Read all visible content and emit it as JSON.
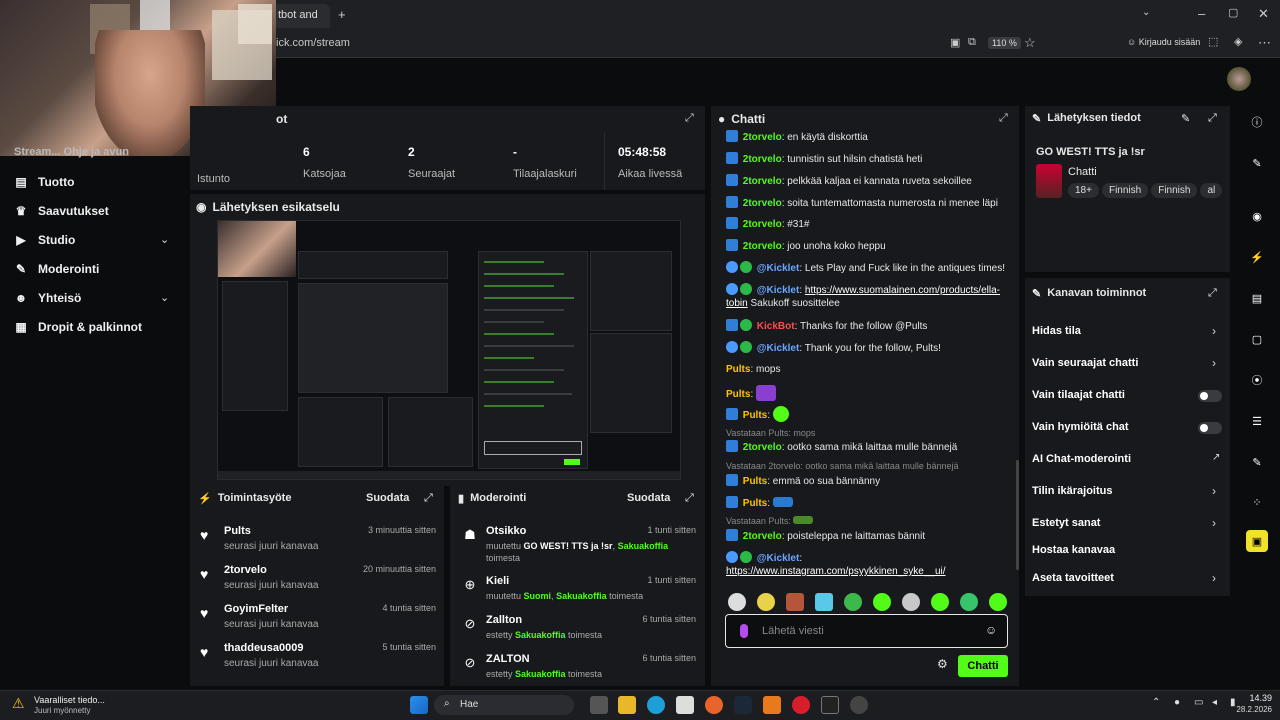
{
  "browser": {
    "tab_title": "tbot and",
    "url": "ick.com/stream",
    "zoom": "110 %",
    "login_label": "Kirjaudu sisään"
  },
  "sidebar": {
    "partial_top_label": "Stream... Ohje ja avun",
    "items": [
      {
        "label": "Tuotto",
        "icon": "money-icon"
      },
      {
        "label": "Saavutukset",
        "icon": "trophy-icon"
      },
      {
        "label": "Studio",
        "icon": "video-icon"
      },
      {
        "label": "Moderointi",
        "icon": "wrench-icon"
      },
      {
        "label": "Yhteisö",
        "icon": "user-icon"
      },
      {
        "label": "Dropit & palkinnot",
        "icon": "gift-icon"
      }
    ]
  },
  "stats": {
    "title_partial": "ot",
    "session_label": "Istunto",
    "items": [
      {
        "value": "6",
        "label": "Katsojaa"
      },
      {
        "value": "2",
        "label": "Seuraajat"
      },
      {
        "value": "-",
        "label": "Tilaajalaskuri"
      },
      {
        "value": "05:48:58",
        "label": "Aikaa livessä"
      }
    ]
  },
  "preview": {
    "title": "Lähetyksen esikatselu"
  },
  "activity": {
    "title": "Toimintasyöte",
    "filter": "Suodata",
    "rows": [
      {
        "name": "Pults",
        "sub": "seurasi juuri kanavaa",
        "time": "3 minuuttia sitten"
      },
      {
        "name": "2torvelo",
        "sub": "seurasi juuri kanavaa",
        "time": "20 minuuttia sitten"
      },
      {
        "name": "GoyimFelter",
        "sub": "seurasi juuri kanavaa",
        "time": "4 tuntia sitten"
      },
      {
        "name": "thaddeusa0009",
        "sub": "seurasi juuri kanavaa",
        "time": "5 tuntia sitten"
      }
    ]
  },
  "moderation": {
    "title": "Moderointi",
    "filter": "Suodata",
    "rows": [
      {
        "name": "Otsikko",
        "time": "1 tunti sitten",
        "d1": "muutettu ",
        "d2": "GO WEST! TTS ja !sr",
        "d3": ", ",
        "d4": "Sakuakoffia",
        "d5": " toimesta"
      },
      {
        "name": "Kieli",
        "time": "1 tunti sitten",
        "d1": "muutettu ",
        "d2": "Suomi",
        "d3": ", ",
        "d4": "Sakuakoffia",
        "d5": " toimesta"
      },
      {
        "name": "Zallton",
        "time": "6 tuntia sitten",
        "d1": "estetty ",
        "d2": "",
        "d3": "",
        "d4": "Sakuakoffia",
        "d5": " toimesta"
      },
      {
        "name": "ZALTON",
        "time": "6 tuntia sitten",
        "d1": "estetty ",
        "d2": "",
        "d3": "",
        "d4": "Sakuakoffia",
        "d5": " toimesta"
      }
    ]
  },
  "chat": {
    "title": "Chatti",
    "messages": [
      {
        "user": "2torvelo",
        "text": "en käytä diskorttia"
      },
      {
        "user": "2torvelo",
        "text": "tunnistin sut hilsin chatistä heti"
      },
      {
        "user": "2torvelo",
        "text": "pelkkää kaljaa ei kannata ruveta sekoillee"
      },
      {
        "user": "2torvelo",
        "text": "soita tuntemattomasta numerosta ni menee läpi"
      },
      {
        "user": "2torvelo",
        "text": "#31#"
      },
      {
        "user": "2torvelo",
        "text": "joo unoha koko heppu"
      },
      {
        "user": "@Kicklet",
        "text": "Lets Play and Fuck like in the antiques times!"
      },
      {
        "user": "@Kicklet",
        "link": "https://www.suomalainen.com/products/ella-tobin",
        "text": "Sakukoff suosittelee"
      },
      {
        "user": "KickBot",
        "text": "Thanks for the follow @Pults"
      },
      {
        "user": "@Kicklet",
        "text": "Thank you for the follow, Pults!"
      },
      {
        "user": "Pults",
        "text": "mops"
      },
      {
        "user": "Pults",
        "text": ""
      },
      {
        "user": "Pults",
        "text": ""
      },
      {
        "user": "2torvelo",
        "text": "ootko sama mikä laittaa mulle bännejä",
        "reply": "Vastataan Pults: mops"
      },
      {
        "user": "Pults",
        "text": "emmä oo sua bännänny",
        "reply": "Vastataan 2torvelo: ootko sama mikä laittaa mulle bännejä"
      },
      {
        "user": "Pults",
        "text": ""
      },
      {
        "user": "2torvelo",
        "text": "poisteleppa ne laittamas bännit",
        "reply": "Vastataan Pults:"
      },
      {
        "user": "@Kicklet",
        "link": "https://www.instagram.com/psyykkinen_syke__ui/",
        "text": ""
      }
    ],
    "input_placeholder": "Lähetä viesti",
    "send_label": "Chatti"
  },
  "stream_info": {
    "title": "Lähetyksen tiedot",
    "stream_title": "GO WEST! TTS ja !sr",
    "category": "Chatti",
    "tags": [
      "18+",
      "Finnish",
      "Finnish",
      "al"
    ]
  },
  "channel_actions": {
    "title": "Kanavan toiminnot",
    "items": [
      {
        "label": "Hidas tila",
        "control": "chevron"
      },
      {
        "label": "Vain seuraajat chatti",
        "control": "chevron"
      },
      {
        "label": "Vain tilaajat chatti",
        "control": "toggle"
      },
      {
        "label": "Vain hymiöitä chat",
        "control": "toggle"
      },
      {
        "label": "AI Chat-moderointi",
        "control": "external"
      },
      {
        "label": "Tilin ikärajoitus",
        "control": "chevron"
      },
      {
        "label": "Estetyt sanat",
        "control": "chevron"
      },
      {
        "label": "Hostaa kanavaa",
        "control": "none"
      },
      {
        "label": "Aseta tavoitteet",
        "control": "chevron"
      }
    ]
  },
  "taskbar": {
    "notification_title": "Vaaralliset tiedo...",
    "notification_sub": "Juuri myönnetty",
    "search": "Hae",
    "time": "14.39",
    "date": "28.2.2026"
  },
  "colors": {
    "accent": "#53fc18",
    "panel": "#18191c",
    "background": "#0b0c0e"
  }
}
